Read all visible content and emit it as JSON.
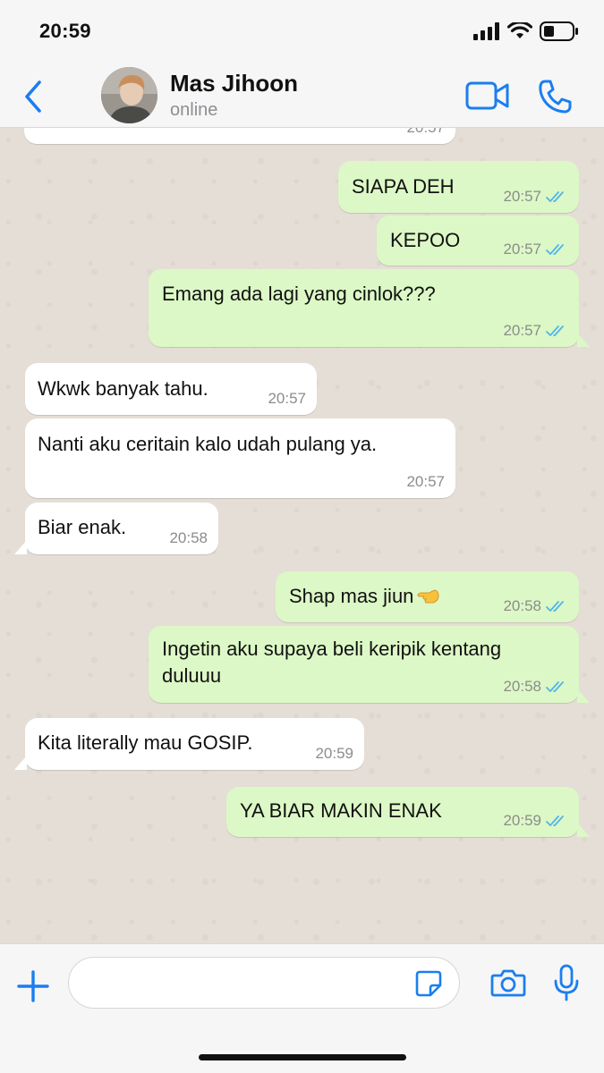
{
  "status_bar": {
    "time": "20:59"
  },
  "header": {
    "contact_name": "Mas Jihoon",
    "contact_status": "online",
    "accent_color": "#1a7ef0"
  },
  "messages": [
    {
      "direction": "in",
      "text": "",
      "time": "20:57",
      "read": false
    },
    {
      "direction": "out",
      "text": "SIAPA DEH",
      "time": "20:57",
      "read": true
    },
    {
      "direction": "out",
      "text": "KEPOO",
      "time": "20:57",
      "read": true
    },
    {
      "direction": "out",
      "text": "Emang ada lagi yang cinlok???",
      "time": "20:57",
      "read": true
    },
    {
      "direction": "in",
      "text": "Wkwk banyak tahu.",
      "time": "20:57",
      "read": false
    },
    {
      "direction": "in",
      "text": "Nanti aku ceritain kalo udah pulang ya.",
      "time": "20:57",
      "read": false
    },
    {
      "direction": "in",
      "text": "Biar enak.",
      "time": "20:58",
      "read": false
    },
    {
      "direction": "out",
      "text": "Shap mas jiun",
      "time": "20:58",
      "read": true,
      "emoji": "pointing-hand-emoji"
    },
    {
      "direction": "out",
      "text_lines": [
        "Ingetin aku supaya beli keripik kentang",
        "duluuu"
      ],
      "time": "20:58",
      "read": true
    },
    {
      "direction": "in",
      "text": "Kita literally mau GOSIP.",
      "time": "20:59",
      "read": false
    },
    {
      "direction": "out",
      "text": "YA BIAR MAKIN ENAK",
      "time": "20:59",
      "read": true
    }
  ],
  "colors": {
    "outgoing_bubble": "#dcf8c6",
    "incoming_bubble": "#ffffff",
    "read_ticks": "#4fb6ec",
    "chat_background": "#e5ded6"
  },
  "composer": {
    "placeholder": "",
    "value": ""
  }
}
